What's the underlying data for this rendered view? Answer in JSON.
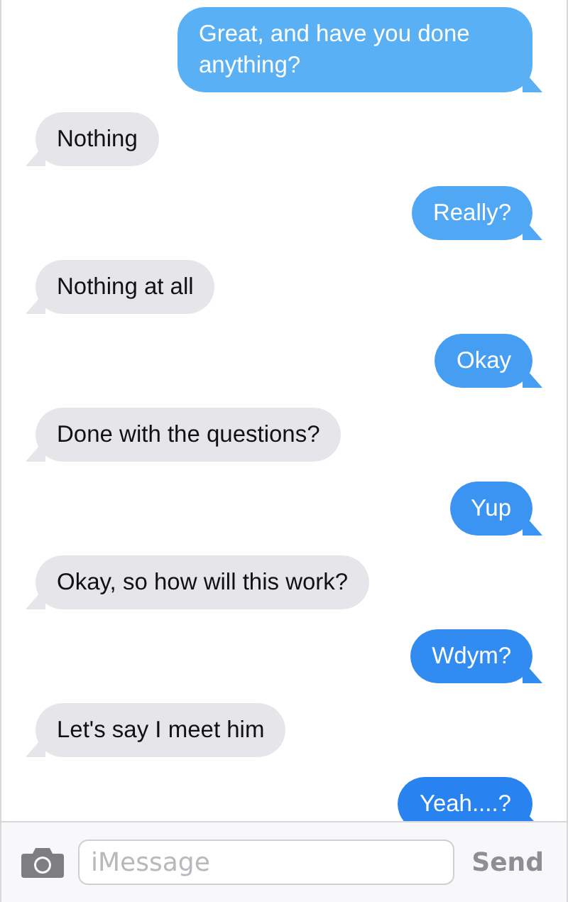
{
  "messages": [
    {
      "kind": "sent",
      "text": "Great, and have you done anything?"
    },
    {
      "kind": "received",
      "text": "Nothing"
    },
    {
      "kind": "sent",
      "text": "Really?"
    },
    {
      "kind": "received",
      "text": "Nothing at all"
    },
    {
      "kind": "sent",
      "text": "Okay"
    },
    {
      "kind": "received",
      "text": "Done with the questions?"
    },
    {
      "kind": "sent",
      "text": "Yup"
    },
    {
      "kind": "received",
      "text": "Okay, so how will this work?"
    },
    {
      "kind": "sent",
      "text": "Wdym?"
    },
    {
      "kind": "received",
      "text": "Let's say I meet him"
    },
    {
      "kind": "sent",
      "text": "Yeah....?"
    }
  ],
  "composer": {
    "placeholder": "iMessage",
    "send": "Send"
  }
}
